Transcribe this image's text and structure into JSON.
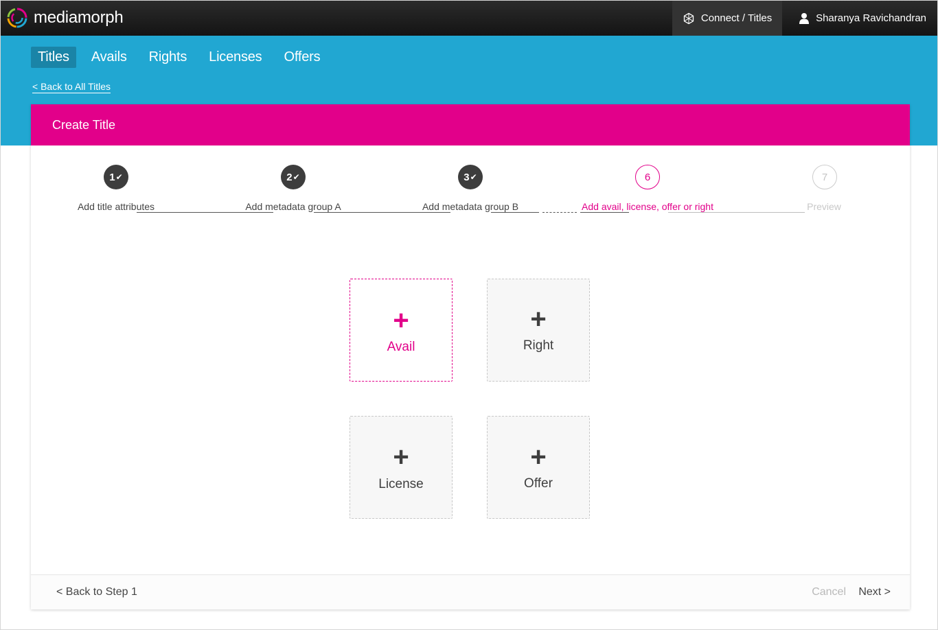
{
  "brand": {
    "name": "mediamorph"
  },
  "topbar": {
    "connect_label": "Connect / Titles",
    "connect_icon": "network-globe-icon",
    "user_name": "Sharanya Ravichandran",
    "user_icon": "user-icon"
  },
  "nav": {
    "items": [
      "Titles",
      "Avails",
      "Rights",
      "Licenses",
      "Offers"
    ],
    "active": "Titles",
    "back_link": "< Back to All Titles"
  },
  "card": {
    "title": "Create Title"
  },
  "stepper": {
    "steps": [
      {
        "number": "1",
        "label": "Add title attributes",
        "state": "done"
      },
      {
        "number": "2",
        "label": "Add metadata group A",
        "state": "done"
      },
      {
        "number": "3",
        "label": "Add metadata group B",
        "state": "done"
      },
      {
        "number": "6",
        "label": "Add avail, license, offer or right",
        "state": "current"
      },
      {
        "number": "7",
        "label": "Preview",
        "state": "future"
      }
    ],
    "check_glyph": "✔"
  },
  "tiles": {
    "plus_glyph": "+",
    "items": [
      {
        "label": "Avail",
        "active": true
      },
      {
        "label": "Right",
        "active": false
      },
      {
        "label": "License",
        "active": false
      },
      {
        "label": "Offer",
        "active": false
      }
    ]
  },
  "footer": {
    "back_label": "< Back to Step 1",
    "cancel_label": "Cancel",
    "next_label": "Next >"
  },
  "colors": {
    "brand_pink": "#e2008a",
    "nav_blue": "#21a7d2",
    "nav_active": "#1a84a7",
    "dark": "#3d3d3d"
  }
}
